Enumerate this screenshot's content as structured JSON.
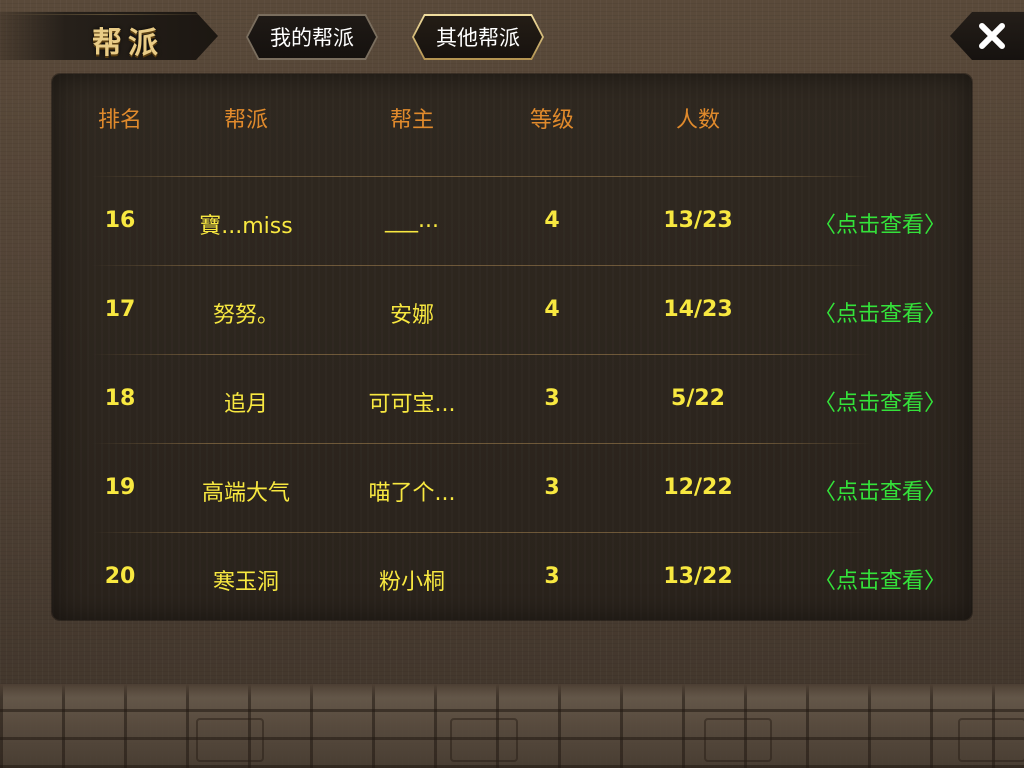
{
  "header": {
    "title": "帮派",
    "tabs": [
      {
        "label": "我的帮派",
        "active": false
      },
      {
        "label": "其他帮派",
        "active": true
      }
    ],
    "close_icon": "close-icon"
  },
  "table": {
    "columns": [
      "排名",
      "帮派",
      "帮主",
      "等级",
      "人数"
    ],
    "rows": [
      {
        "rank": "16",
        "guild": "寶...miss",
        "leader": "___...",
        "level": "4",
        "members": "13/23",
        "action": "〈点击查看〉"
      },
      {
        "rank": "17",
        "guild": "努努。",
        "leader": "安娜",
        "level": "4",
        "members": "14/23",
        "action": "〈点击查看〉"
      },
      {
        "rank": "18",
        "guild": "追月",
        "leader": "可可宝...",
        "level": "3",
        "members": "5/22",
        "action": "〈点击查看〉"
      },
      {
        "rank": "19",
        "guild": "高端大气",
        "leader": "喵了个...",
        "level": "3",
        "members": "12/22",
        "action": "〈点击查看〉"
      },
      {
        "rank": "20",
        "guild": "寒玉洞",
        "leader": "粉小桐",
        "level": "3",
        "members": "13/22",
        "action": "〈点击查看〉"
      }
    ]
  },
  "colors": {
    "header_text": "#e08a2c",
    "cell_text": "#f8e840",
    "link_text": "#34e23a",
    "title_text": "#e9cc86"
  }
}
